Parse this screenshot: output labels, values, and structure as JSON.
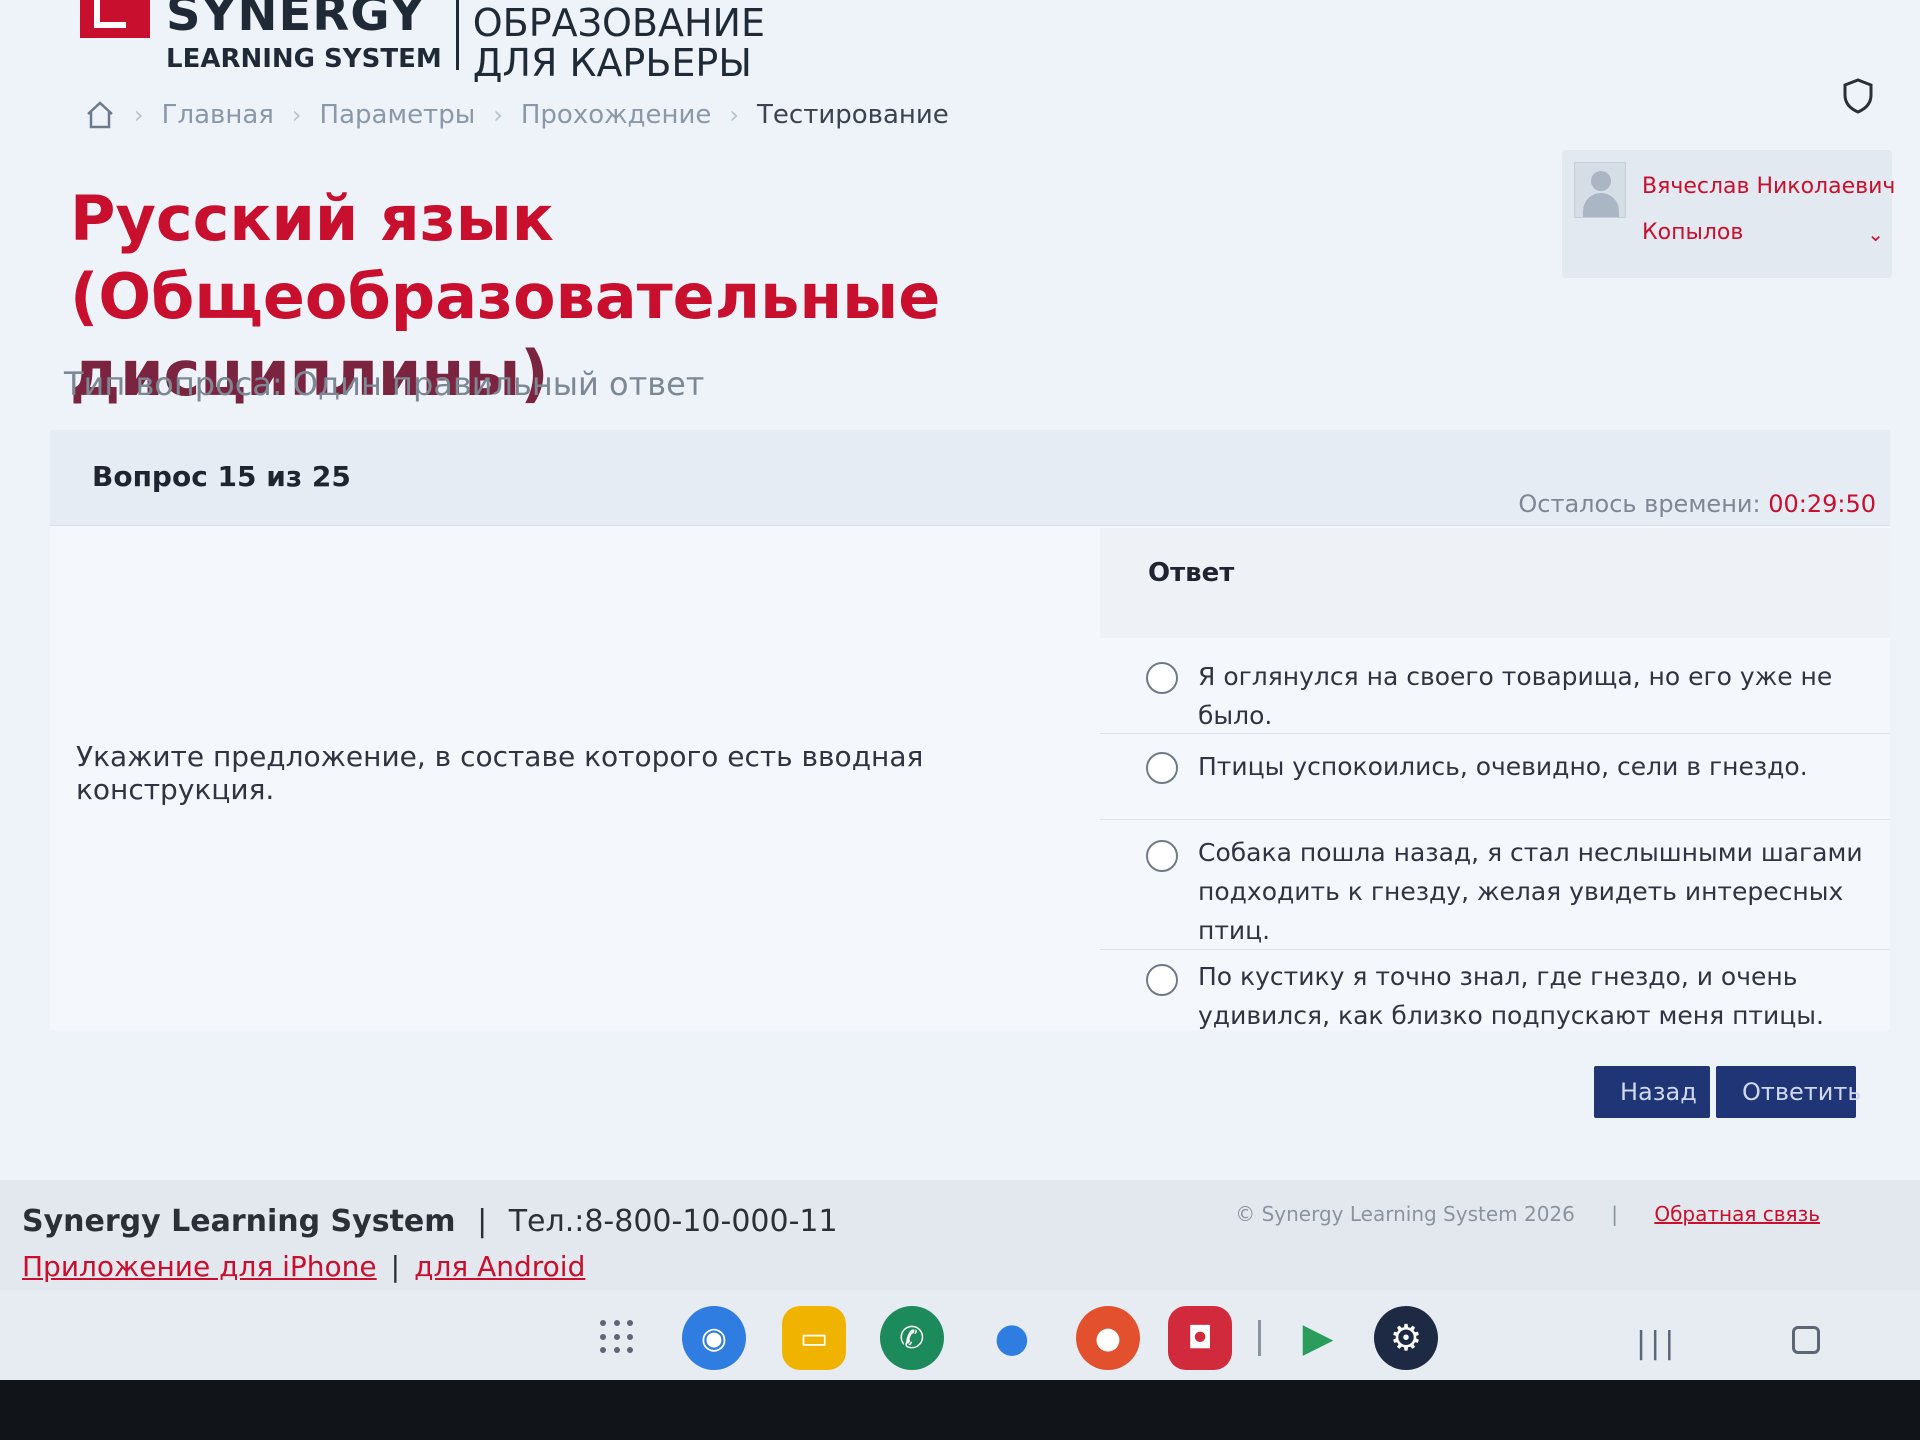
{
  "header": {
    "logo_brand": "SYNERGY",
    "logo_sub": "LEARNING SYSTEM",
    "logo_tag_line1": "ОБРАЗОВАНИЕ",
    "logo_tag_line2": "ДЛЯ КАРЬЕРЫ"
  },
  "breadcrumb": {
    "items": [
      "Главная",
      "Параметры",
      "Прохождение",
      "Тестирование"
    ],
    "separator": "›"
  },
  "user": {
    "first_name": "Вячеслав Николаевич",
    "last_name": "Копылов",
    "chevron": "⌄"
  },
  "title": {
    "line1": "Русский язык (Общеобразовательные",
    "line2": "дисциплины)"
  },
  "question_type": "Тип вопроса: Один правильный ответ",
  "question": {
    "counter": "Вопрос 15 из 25",
    "timer_label": "Осталось времени: ",
    "timer_value": "00:29:50",
    "text": "Укажите предложение, в составе которого есть вводная конструкция.",
    "answer_label": "Ответ",
    "options": [
      "Я оглянулся на своего товарища, но его уже не было.",
      "Птицы успокоились, очевидно, сели в гнездо.",
      "Собака пошла назад, я стал неслышными шагами подходить к гнезду, желая увидеть интересных птиц.",
      "По кустику я точно знал, где гнездо, и очень удивился, как близко подпускают меня птицы."
    ]
  },
  "buttons": {
    "back": "Назад",
    "submit": "Ответить"
  },
  "footer": {
    "brand": "Synergy Learning System",
    "separator": "|",
    "phone": "Тел.:8-800-10-000-11",
    "iphone_link": "Приложение для iPhone",
    "android_link": "для Android",
    "copyright": "© Synergy Learning System 2026",
    "feedback_link": "Обратная связь"
  },
  "taskbar": {
    "icons": [
      "apps-grid-icon",
      "browser-icon",
      "files-icon",
      "phone-icon",
      "messages-icon",
      "contacts-icon",
      "camera-icon",
      "play-store-icon",
      "settings-icon"
    ],
    "nav_recent": "|||"
  },
  "colors": {
    "brand_red": "#c8102e",
    "button_navy": "#1f3575"
  }
}
